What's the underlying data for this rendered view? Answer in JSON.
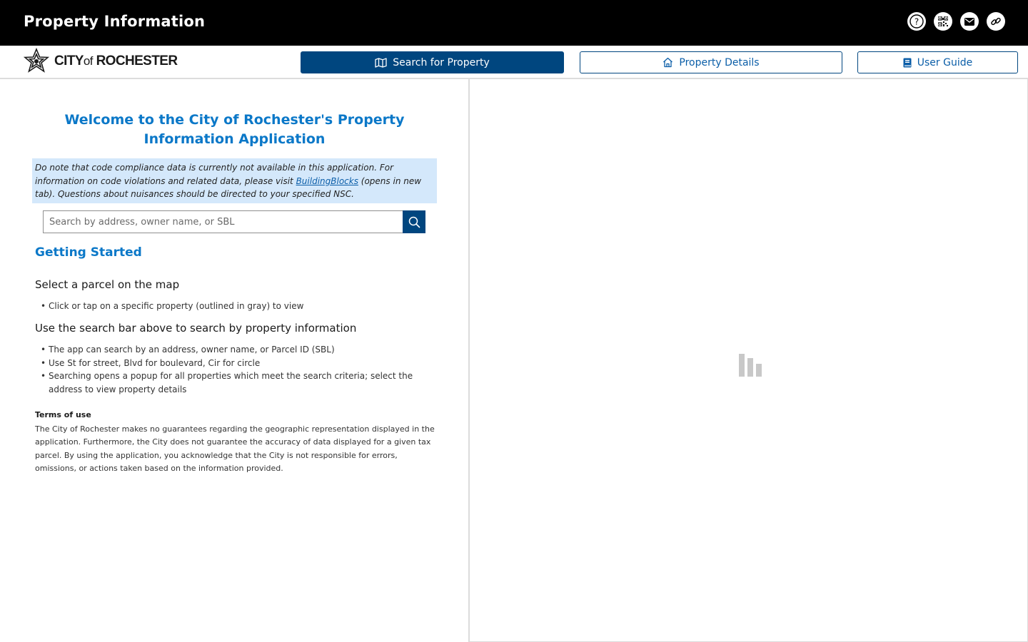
{
  "header": {
    "title": "Property Information",
    "icons": [
      "help-icon",
      "qr-code-icon",
      "email-icon",
      "link-icon"
    ]
  },
  "nav": {
    "logo": {
      "prefix": "CITY",
      "middle": "of",
      "suffix": "ROCHESTER"
    },
    "tabs": [
      {
        "label": "Search for Property",
        "icon": "map-icon",
        "active": true
      },
      {
        "label": "Property Details",
        "icon": "home-icon",
        "active": false
      },
      {
        "label": "User Guide",
        "icon": "book-icon",
        "active": false
      }
    ]
  },
  "panel": {
    "welcome": "Welcome to the City of Rochester's Property Information Application",
    "notice": {
      "before": "Do note that code compliance data is currently not available in this application. For information on code violations and related data, please visit ",
      "link": "BuildingBlocks",
      "after": " (opens in new tab). Questions about nuisances should be directed to your specified NSC."
    },
    "search": {
      "placeholder": "Search by address, owner name, or SBL",
      "value": ""
    },
    "getting_started": "Getting Started",
    "select_heading": "Select a parcel on the map",
    "select_items": [
      "Click or tap on a specific property (outlined in gray) to view"
    ],
    "use_heading": "Use the search bar above to search by property information",
    "use_items": [
      "The app can search by an address, owner name, or Parcel ID (SBL)",
      "Use St for street, Blvd for boulevard, Cir for circle",
      "Searching opens a popup for all properties which meet the search criteria; select the address to view property details"
    ],
    "terms_title": "Terms of use",
    "terms_text": "The City of Rochester makes no guarantees regarding the geographic representation displayed in the application. Furthermore, the City does not guarantee the accuracy of data displayed for a given tax parcel. By using the application, you acknowledge that the City is not responsible for errors, omissions, or actions taken based on the information provided."
  },
  "colors": {
    "topbar": "#000000",
    "accent": "#00467f",
    "link_blue": "#0b78c8",
    "notice_bg": "#d4e8fb"
  }
}
